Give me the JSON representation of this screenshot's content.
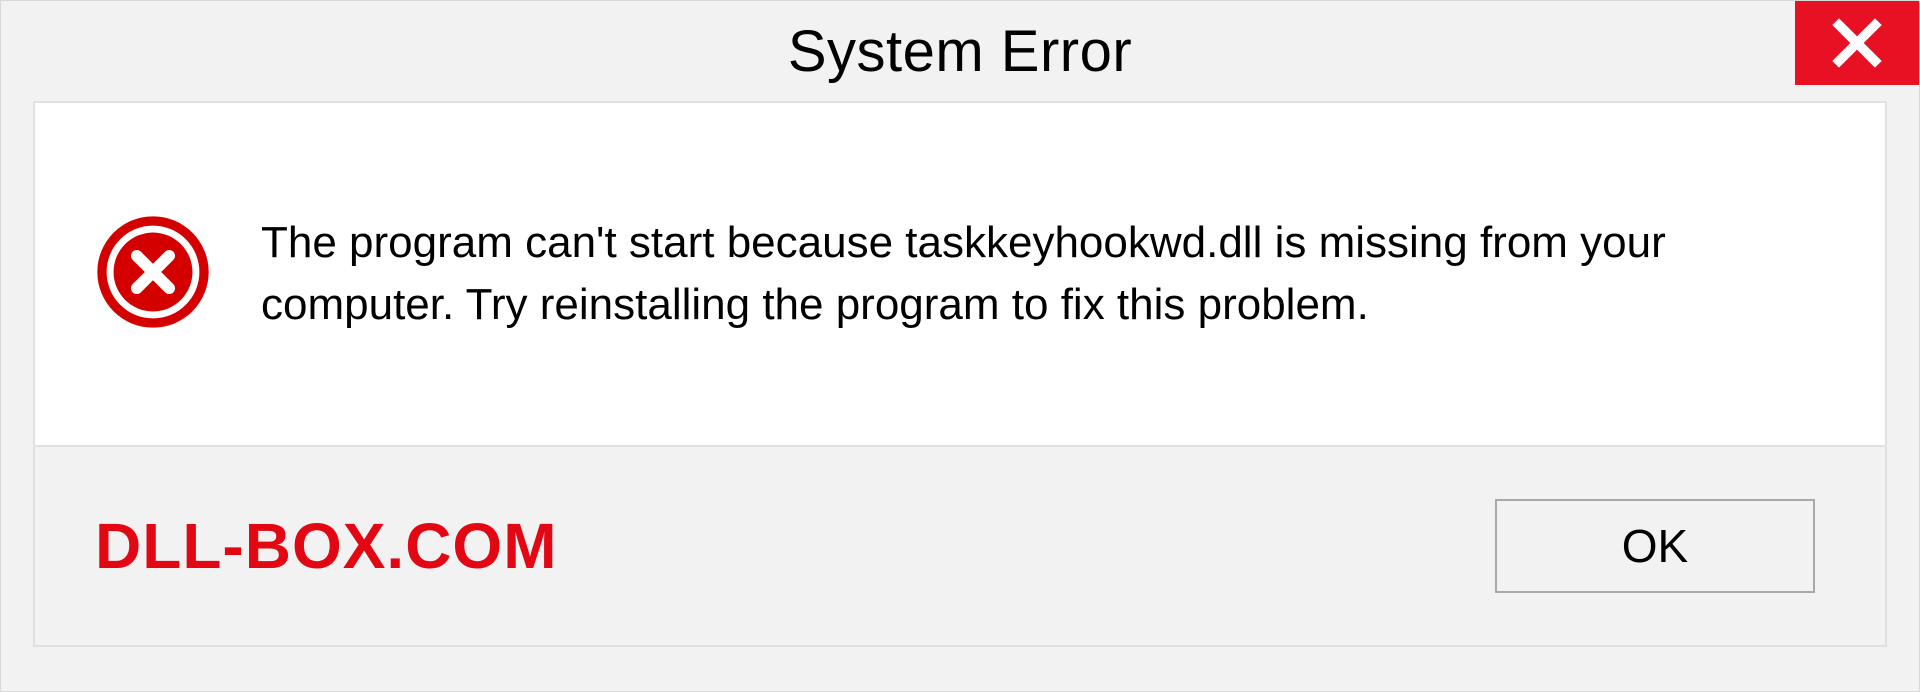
{
  "title": "System Error",
  "message": "The program can't start because taskkeyhookwd.dll is missing from your computer. Try reinstalling the program to fix this problem.",
  "watermark": "DLL-BOX.COM",
  "buttons": {
    "ok": "OK"
  }
}
